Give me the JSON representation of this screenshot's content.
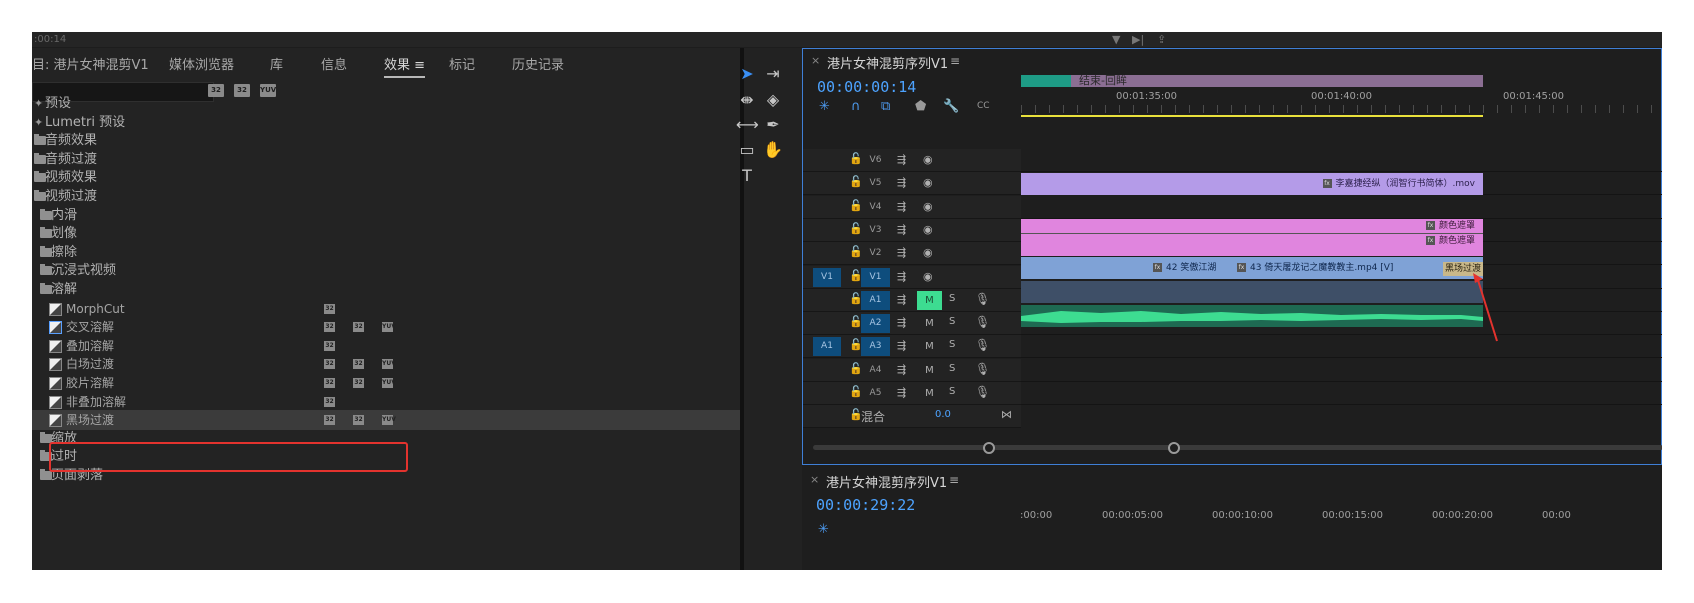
{
  "topbar": {
    "timecode": ":00:14"
  },
  "effects_panel": {
    "tabs": [
      {
        "label": "目: 港片女神混剪V1"
      },
      {
        "label": "媒体浏览器"
      },
      {
        "label": "库"
      },
      {
        "label": "信息"
      },
      {
        "label": "效果"
      },
      {
        "label": "标记"
      },
      {
        "label": "历史记录"
      }
    ],
    "active_tab_menu": "≡",
    "accel_badges": [
      "32",
      "32",
      "YUV"
    ],
    "tree": [
      {
        "label": "预设",
        "kind": "star"
      },
      {
        "label": "Lumetri 预设",
        "kind": "star"
      },
      {
        "label": "音频效果",
        "kind": "folder"
      },
      {
        "label": "音频过渡",
        "kind": "folder"
      },
      {
        "label": "视频效果",
        "kind": "folder"
      },
      {
        "label": "视频过渡",
        "kind": "folder"
      },
      {
        "label": "内滑",
        "kind": "folder"
      },
      {
        "label": "划像",
        "kind": "folder"
      },
      {
        "label": "擦除",
        "kind": "folder"
      },
      {
        "label": "沉浸式视频",
        "kind": "folder"
      },
      {
        "label": "溶解",
        "kind": "folder"
      },
      {
        "label": "MorphCut",
        "kind": "effect",
        "badges": [
          "32"
        ]
      },
      {
        "label": "交叉溶解",
        "kind": "effect",
        "badges": [
          "32",
          "32",
          "YUV"
        ]
      },
      {
        "label": "叠加溶解",
        "kind": "effect",
        "badges": [
          "32"
        ]
      },
      {
        "label": "白场过渡",
        "kind": "effect",
        "badges": [
          "32",
          "32",
          "YUV"
        ]
      },
      {
        "label": "胶片溶解",
        "kind": "effect",
        "badges": [
          "32",
          "32",
          "YUV"
        ]
      },
      {
        "label": "非叠加溶解",
        "kind": "effect",
        "badges": [
          "32"
        ]
      },
      {
        "label": "黑场过渡",
        "kind": "effect",
        "badges": [
          "32",
          "32",
          "YUV"
        ],
        "selected": true
      },
      {
        "label": "缩放",
        "kind": "folder"
      },
      {
        "label": "过时",
        "kind": "folder"
      },
      {
        "label": "页面剥落",
        "kind": "folder"
      }
    ]
  },
  "tools": [
    "selection-tool",
    "track-select-tool",
    "ripple-edit-tool",
    "razor-tool",
    "slip-tool",
    "pen-tool",
    "rectangle-tool",
    "hand-tool",
    "type-tool"
  ],
  "timeline1": {
    "title": "港片女神混剪序列V1",
    "menu": "≡",
    "timecode": "00:00:00:14",
    "ruler_labels": [
      "00:01:35:00",
      "00:01:40:00",
      "00:01:45:00"
    ],
    "marker_label": "结束-回眸",
    "tracks": [
      {
        "name": "V6",
        "type": "video"
      },
      {
        "name": "V5",
        "type": "video"
      },
      {
        "name": "V4",
        "type": "video"
      },
      {
        "name": "V3",
        "type": "video"
      },
      {
        "name": "V2",
        "type": "video"
      },
      {
        "name": "V1",
        "type": "video",
        "src": "V1",
        "on": true
      },
      {
        "name": "A1",
        "type": "audio",
        "on": true,
        "mute_on": true
      },
      {
        "name": "A2",
        "type": "audio",
        "on": true
      },
      {
        "name": "A3",
        "type": "audio",
        "src": "A1",
        "on": true
      },
      {
        "name": "A4",
        "type": "audio"
      },
      {
        "name": "A5",
        "type": "audio"
      }
    ],
    "mix": {
      "label": "混合",
      "value": "0.0"
    },
    "m_label": "M",
    "s_label": "S",
    "clips": {
      "v5": "李嘉捷经纵（润智行书简体）.mov",
      "v3": "颜色遮罩",
      "v2": "颜色遮罩",
      "v1a": "42 笑傲江湖",
      "v1b": "43 倚天屠龙记之魔教教主.mp4 [V]",
      "v1c": "黑场过渡"
    }
  },
  "timeline2": {
    "title": "港片女神混剪序列V1",
    "menu": "≡",
    "timecode": "00:00:29:22",
    "ruler_labels": [
      ":00:00",
      "00:00:05:00",
      "00:00:10:00",
      "00:00:15:00",
      "00:00:20:00",
      "00:00"
    ]
  },
  "colors": {
    "accent": "#4da3ff",
    "highlight_box": "#e3332e",
    "audio_mute": "#3ddc91"
  }
}
